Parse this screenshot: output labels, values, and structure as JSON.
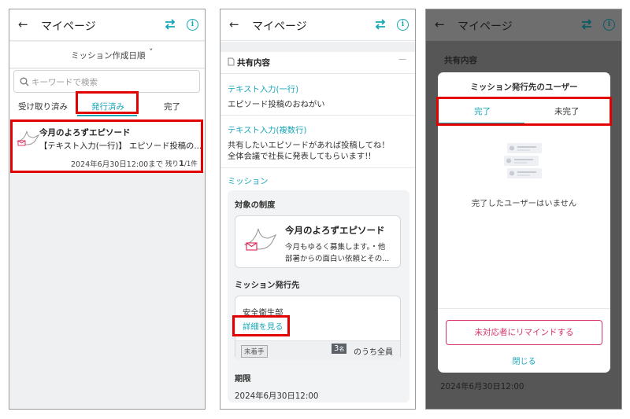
{
  "colors": {
    "accent": "#17a6b8",
    "highlight": "#e30000",
    "remind": "#d6336c"
  },
  "header": {
    "back_icon": "left-arrow-icon",
    "title": "マイページ",
    "swap_icon": "swap-arrows-icon",
    "info_icon": "info-icon",
    "info_glyph": "i"
  },
  "screen1": {
    "sort_label": "ミッション作成日順",
    "sort_chevron": "˅",
    "search_placeholder": "キーワードで検索",
    "tabs": [
      "受け取り済み",
      "発行済み",
      "完了"
    ],
    "selected_tab": "発行済み",
    "card": {
      "title": "今月のよろずエピソード",
      "subtitle": "【テキスト入力(一行)】 エピソード投稿の...",
      "deadline": "2024年6月30日12:00まで",
      "remaining_prefix": "残り",
      "remaining_count": "1",
      "remaining_total": "/1件"
    }
  },
  "screen2": {
    "section_title": "共有内容",
    "collapse_glyph": "—",
    "fields": [
      {
        "label": "テキスト入力(一行)",
        "value": "エピソード投稿のおねがい"
      },
      {
        "label": "テキスト入力(複数行)",
        "value_line1": "共有したいエピソードがあれば投稿してね！",
        "value_line2": "全体会議で社長に発表してもらいます!!"
      }
    ],
    "mission_label": "ミッション",
    "target_label": "対象の制度",
    "mission_card": {
      "title": "今月のよろずエピソード",
      "desc_line1": "今月もゆるく募集します。・他",
      "desc_line2": "部署からの面白い依頼とその..."
    },
    "issue_to_label": "ミッション発行先",
    "department": "安全衛生部",
    "detail_link": "詳細を見る",
    "status_badge": "未着手",
    "count_number": "3",
    "count_unit": "名",
    "count_suffix": "のうち全員",
    "deadline_label": "期限",
    "deadline_value": "2024年6月30日12:00"
  },
  "screen3": {
    "bg_section_title": "共有内容",
    "bg_deadline": "2024年6月30日12:00",
    "modal_title": "ミッション発行先のユーザー",
    "tabs": [
      "完了",
      "未完了"
    ],
    "selected_tab": "完了",
    "empty_message": "完了したユーザーはいません",
    "remind_button": "未対応者にリマインドする",
    "close_button": "閉じる"
  }
}
